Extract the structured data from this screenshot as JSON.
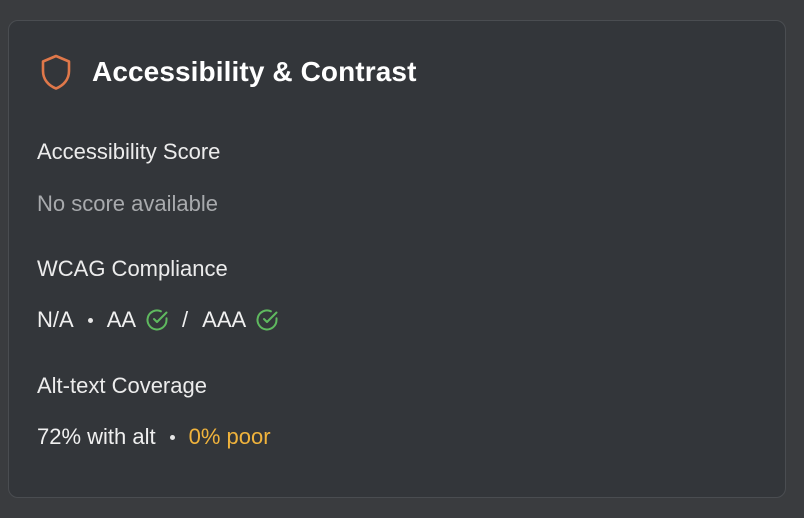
{
  "card": {
    "title": "Accessibility & Contrast",
    "icon": "shield-icon",
    "accent_color": "#e0784a"
  },
  "score": {
    "label": "Accessibility Score",
    "value": "No score available"
  },
  "wcag": {
    "label": "WCAG Compliance",
    "ratio": "N/A",
    "aa_label": "AA",
    "aa_icon": "check-circle-icon",
    "separator": "/",
    "aaa_label": "AAA",
    "aaa_icon": "check-circle-icon",
    "check_color": "#5fb95f"
  },
  "alt_text": {
    "label": "Alt-text Coverage",
    "coverage": "72% with alt",
    "poor": "0% poor",
    "poor_color": "#f0b33c"
  }
}
